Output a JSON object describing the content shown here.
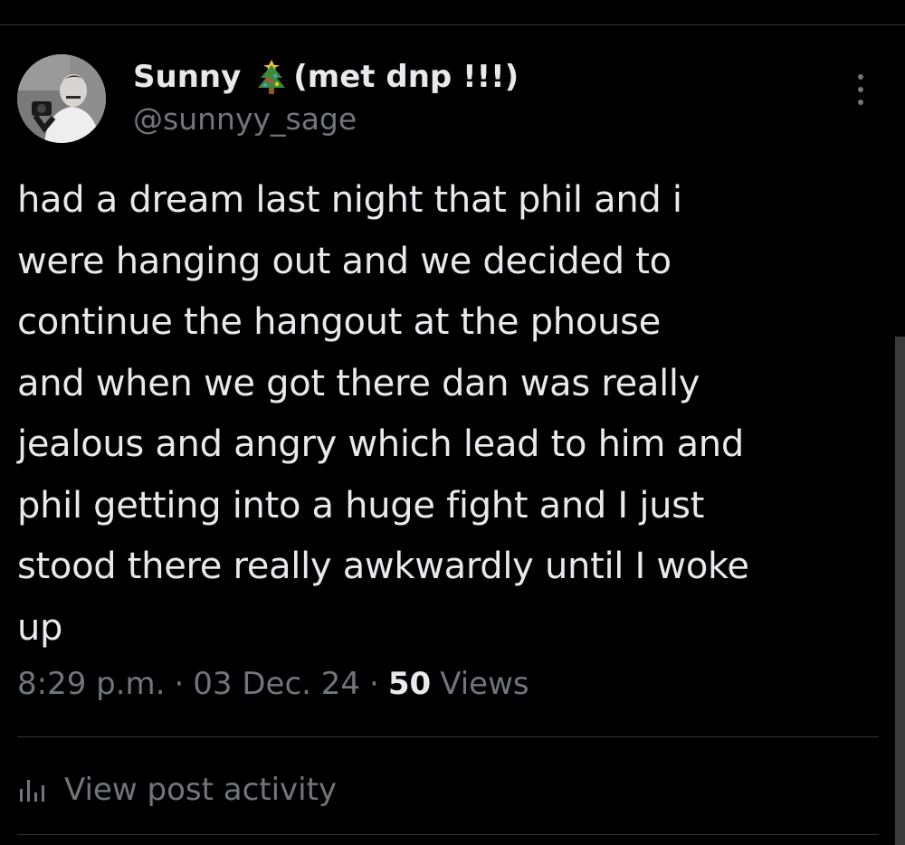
{
  "post": {
    "author": {
      "display_name": "Sunny",
      "display_name_emoji": "christmas-tree-icon",
      "display_name_suffix": "(met dnp !!!)",
      "handle": "@sunnyy_sage"
    },
    "text_lines": [
      "had a dream last night that phil and i",
      "were hanging out and we decided to",
      "continue the hangout at the phouse",
      "and when we got there dan was really",
      "jealous and angry which lead to him and",
      "phil getting into a huge fight and I just",
      "stood there really awkwardly until I woke",
      "up"
    ],
    "time": "8:29 p.m.",
    "separator": "·",
    "date": "03 Dec. 24",
    "views_count": "50",
    "views_label": "Views",
    "activity_label": "View post activity"
  },
  "icons": {
    "more": "more-vertical-icon",
    "activity": "bar-chart-icon"
  },
  "colors": {
    "background": "#000000",
    "primary_text": "#e7e9ea",
    "secondary_text": "#71767b",
    "divider": "#2f3336"
  }
}
